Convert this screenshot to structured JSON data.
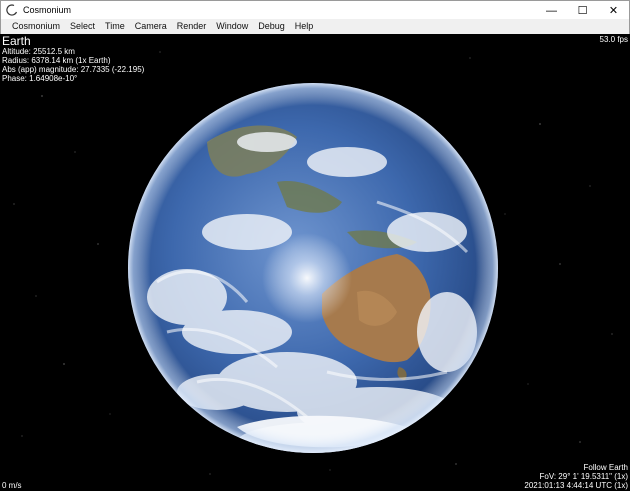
{
  "window": {
    "title": "Cosmonium",
    "controls": {
      "minimize": "—",
      "maximize": "☐",
      "close": "✕"
    }
  },
  "menu": {
    "items": [
      "Cosmonium",
      "Select",
      "Time",
      "Camera",
      "Render",
      "Window",
      "Debug",
      "Help"
    ]
  },
  "hud": {
    "fps": "53.0 fps",
    "object_name": "Earth",
    "altitude": "Altitude: 25512.5 km",
    "radius": "Radius: 6378.14 km (1x Earth)",
    "magnitude": "Abs (app) magnitude: 27.7335 (-22.195)",
    "phase": "Phase: 1.64908e-10°",
    "speed": "0 m/s",
    "follow": "Follow Earth",
    "fov": "FoV: 29° 1' 19.5311\" (1x)",
    "datetime": "2021:01:13  4:44:14 UTC (1x)"
  },
  "colors": {
    "ocean": "#3a63a8",
    "atmosphere": "#9fc0ea",
    "land_australia": "#a57a4e",
    "cloud": "#f4f6fa",
    "hud_text": "#ffffff",
    "menubar_bg": "#f0f0f0"
  }
}
